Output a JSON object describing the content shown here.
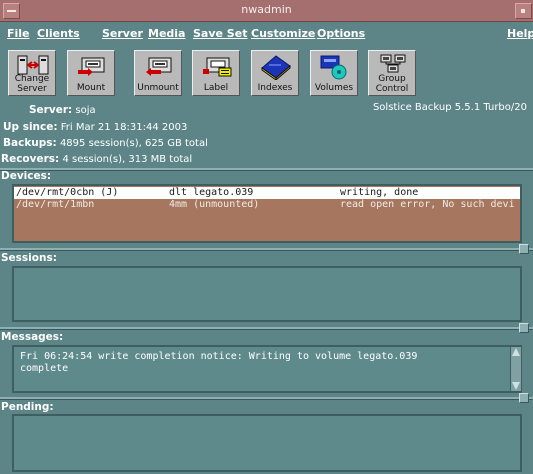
{
  "window": {
    "title": "nwadmin"
  },
  "menu": {
    "file": "File",
    "clients": "Clients",
    "server": "Server",
    "media": "Media",
    "save_set": "Save Set",
    "customize": "Customize",
    "options": "Options",
    "help": "Help"
  },
  "toolbar": {
    "change_server_1": "Change",
    "change_server_2": "Server",
    "mount": "Mount",
    "unmount": "Unmount",
    "label": "Label",
    "indexes": "Indexes",
    "volumes": "Volumes",
    "group_control_1": "Group",
    "group_control_2": "Control"
  },
  "info": {
    "server_label": "Server:",
    "server_value": "soja",
    "up_since_label": "Up since:",
    "up_since_value": "Fri Mar 21 18:31:44 2003",
    "backups_label": "Backups:",
    "backups_value": "4895 session(s), 625 GB total",
    "recovers_label": "Recovers:",
    "recovers_value": "4 session(s), 313 MB total",
    "version": "Solstice Backup 5.5.1 Turbo/20"
  },
  "devices": {
    "label": "Devices:",
    "rows": [
      {
        "device": "/dev/rmt/0cbn (J)",
        "volume": "dlt legato.039",
        "message": "writing, done"
      },
      {
        "device": "/dev/rmt/1mbn",
        "volume": "4mm (unmounted)",
        "message": "read open error, No such devi"
      }
    ]
  },
  "sessions": {
    "label": "Sessions:"
  },
  "messages": {
    "label": "Messages:",
    "line1": "Fri 06:24:54 write completion notice: Writing to volume legato.039",
    "line2": "complete"
  },
  "pending": {
    "label": "Pending:"
  },
  "colors": {
    "background": "#5d8587",
    "titlebar": "#a66f6f",
    "devices_bg": "#a6765e"
  }
}
